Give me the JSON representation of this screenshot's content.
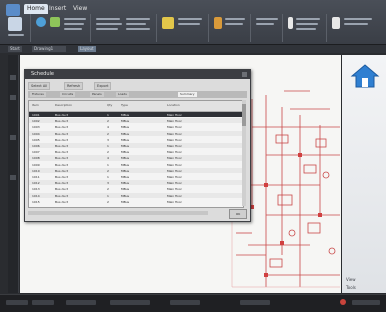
{
  "ribbon": {
    "tabs": [
      {
        "label": "Home"
      },
      {
        "label": "Insert"
      },
      {
        "label": "View"
      }
    ],
    "active_tab": "Home"
  },
  "document_tabs": [
    {
      "label": "Start"
    },
    {
      "label": "Drawing1"
    },
    {
      "label": "Layout"
    }
  ],
  "dialog": {
    "title": "Schedule",
    "toolbar": [
      "Select All",
      "Refresh",
      "Export"
    ],
    "tabs": [
      "Fixtures",
      "Circuits",
      "Panels",
      "Loads",
      "Summary"
    ],
    "columns": [
      "Item",
      "Description",
      "Qty",
      "Type",
      "Location"
    ],
    "rows": [
      [
        "1001",
        "Bus duct",
        "1",
        "MBus",
        "Main floor"
      ],
      [
        "1002",
        "Bus duct",
        "2",
        "MBus",
        "Main floor"
      ],
      [
        "1003",
        "Bus duct",
        "4",
        "MBus",
        "Main floor"
      ],
      [
        "1004",
        "Bus duct",
        "2",
        "MBus",
        "Main floor"
      ],
      [
        "1005",
        "Bus duct",
        "3",
        "MBus",
        "Main floor"
      ],
      [
        "1006",
        "Bus duct",
        "1",
        "MBus",
        "Main floor"
      ],
      [
        "1007",
        "Bus duct",
        "2",
        "MBus",
        "Main floor"
      ],
      [
        "1008",
        "Bus duct",
        "4",
        "MBus",
        "Main floor"
      ],
      [
        "1009",
        "Bus duct",
        "1",
        "MBus",
        "Main floor"
      ],
      [
        "1010",
        "Bus duct",
        "2",
        "MBus",
        "Main floor"
      ],
      [
        "1011",
        "Bus duct",
        "1",
        "MBus",
        "Main floor"
      ],
      [
        "1012",
        "Bus duct",
        "3",
        "MBus",
        "Main floor"
      ],
      [
        "1013",
        "Bus duct",
        "2",
        "MBus",
        "Main floor"
      ],
      [
        "1014",
        "Bus duct",
        "1",
        "MBus",
        "Main floor"
      ],
      [
        "1015",
        "Bus duct",
        "2",
        "MBus",
        "Main floor"
      ]
    ],
    "selected_row": 0,
    "ok_label": "OK"
  },
  "right_panel": {
    "labels": [
      "View",
      "Tools"
    ]
  }
}
